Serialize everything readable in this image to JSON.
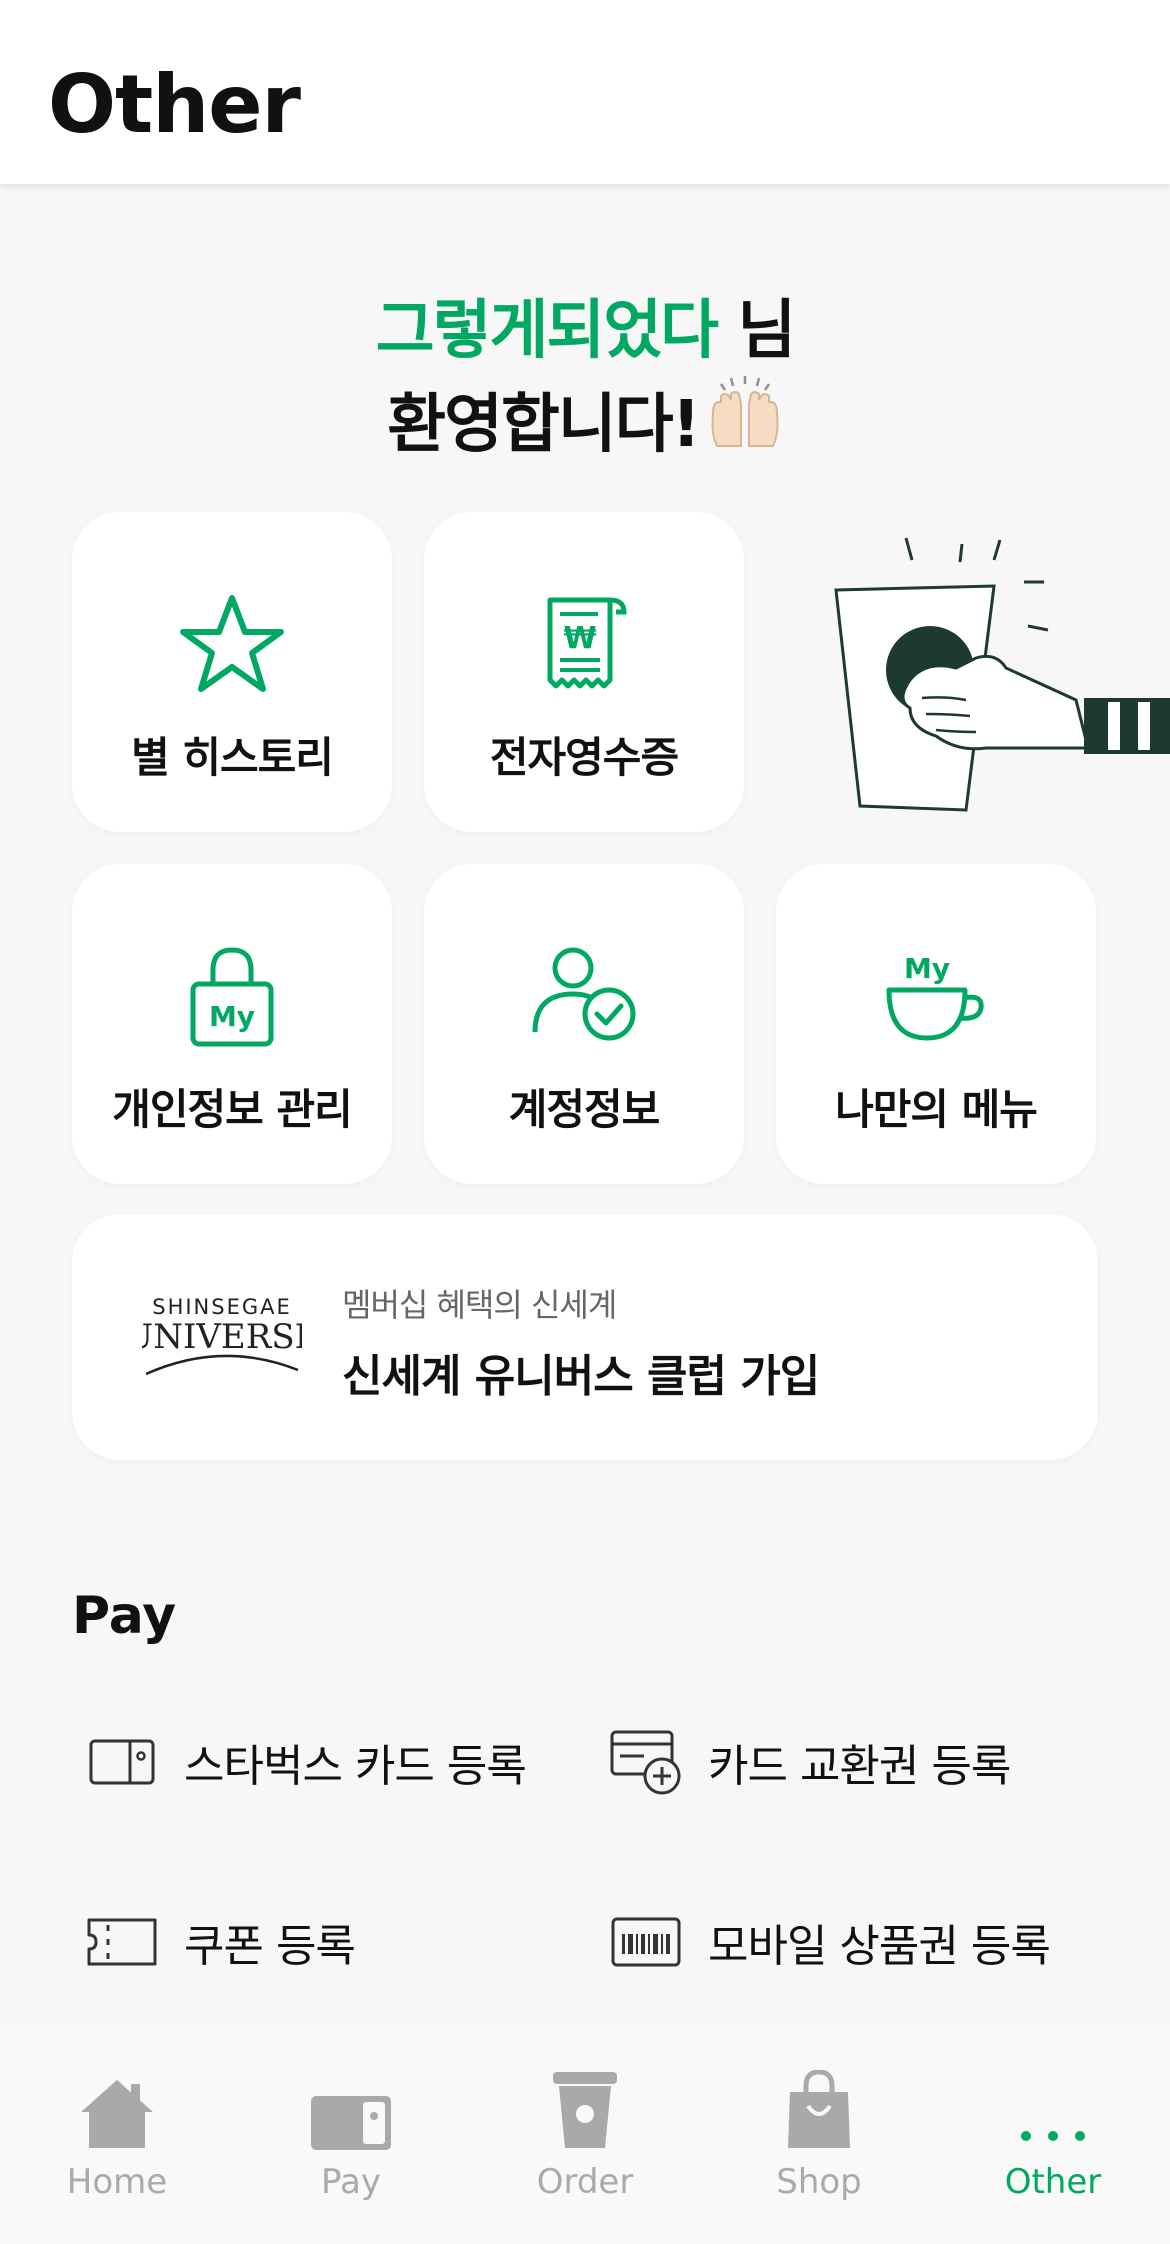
{
  "header": {
    "title": "Other"
  },
  "welcome": {
    "name": "그렇게되었다",
    "honorific": " 님",
    "greeting": "환영합니다!"
  },
  "tiles": [
    {
      "label": "별 히스토리",
      "icon": "star-icon"
    },
    {
      "label": "전자영수증",
      "icon": "receipt-icon"
    },
    {
      "label": "개인정보 관리",
      "icon": "lock-my-icon"
    },
    {
      "label": "계정정보",
      "icon": "account-check-icon"
    },
    {
      "label": "나만의 메뉴",
      "icon": "my-cup-icon"
    }
  ],
  "universe": {
    "logo_top": "SHINSEGAE",
    "logo_bottom": "UNIVERSE",
    "subtitle": "멤버십 혜택의 신세계",
    "title": "신세계 유니버스 클럽 가입"
  },
  "pay": {
    "section_title": "Pay",
    "items": [
      {
        "label": "스타벅스 카드 등록",
        "icon": "card-icon"
      },
      {
        "label": "카드 교환권 등록",
        "icon": "card-add-icon"
      },
      {
        "label": "쿠폰 등록",
        "icon": "coupon-icon"
      },
      {
        "label": "모바일 상품권 등록",
        "icon": "barcode-icon"
      }
    ]
  },
  "tabbar": {
    "items": [
      {
        "label": "Home",
        "icon": "home-icon"
      },
      {
        "label": "Pay",
        "icon": "wallet-icon"
      },
      {
        "label": "Order",
        "icon": "cup-icon"
      },
      {
        "label": "Shop",
        "icon": "bag-icon"
      },
      {
        "label": "Other",
        "icon": "more-icon",
        "active": true
      }
    ]
  },
  "colors": {
    "brand_green": "#00a862",
    "dark_green": "#1e3932"
  }
}
